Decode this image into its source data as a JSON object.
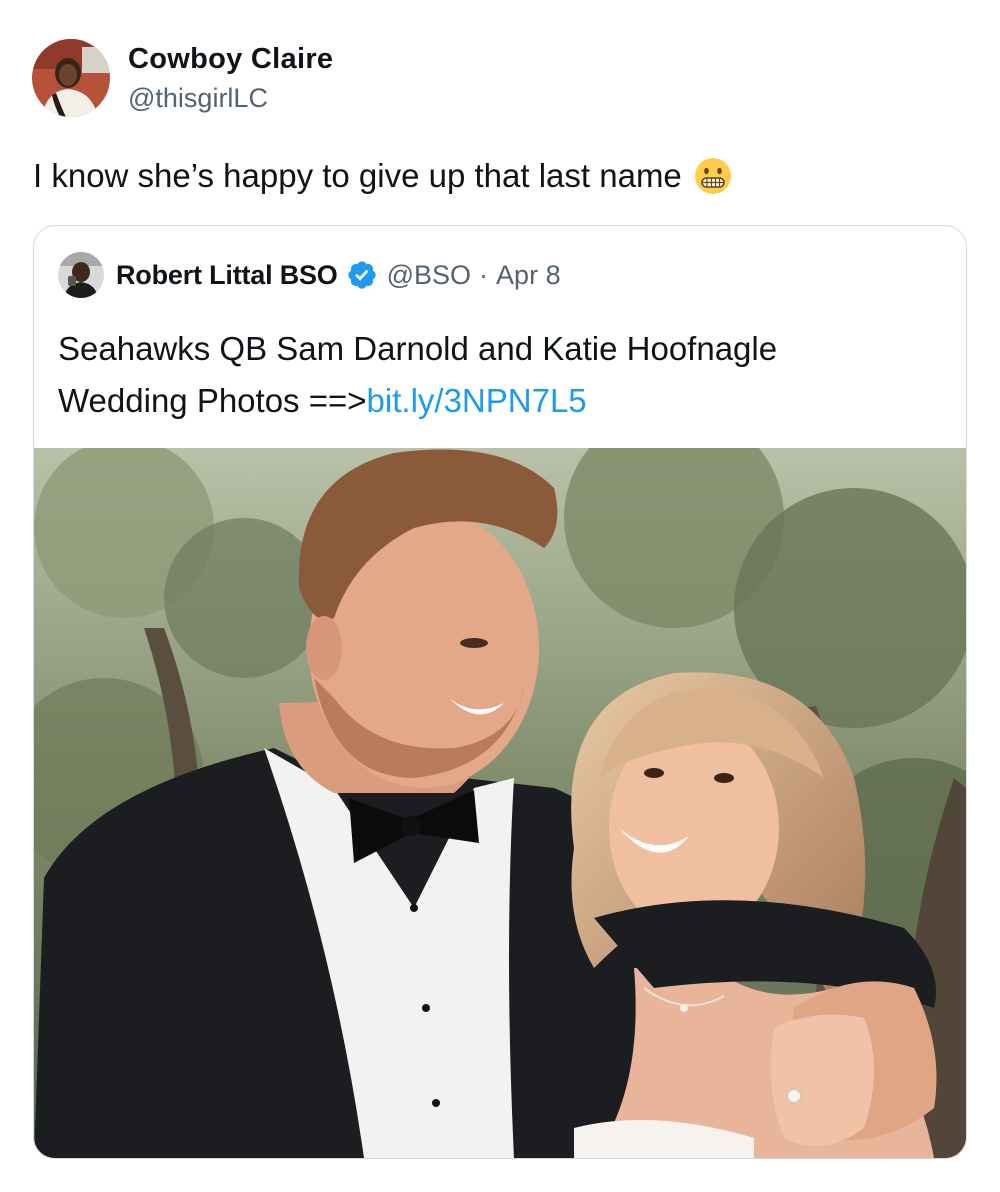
{
  "tweet": {
    "author": {
      "display_name": "Cowboy Claire",
      "handle": "@thisgirlLC",
      "avatar_icon": "profile-photo"
    },
    "text": "I know she’s happy to give up that last name",
    "emoji_icon": "grimacing-face-icon"
  },
  "quoted_tweet": {
    "author": {
      "display_name": "Robert Littal BSO",
      "handle": "@BSO",
      "verified_icon": "verified-badge-icon",
      "avatar_icon": "profile-photo"
    },
    "separator": "·",
    "date": "Apr 8",
    "text_line1": "Seahawks QB Sam Darnold and Katie Hoofnagle",
    "text_line2_prefix": "Wedding Photos ==>",
    "link_text": "bit.ly/3NPN7L5",
    "media_icon": "wedding-photo"
  },
  "colors": {
    "text_primary": "#0f1419",
    "text_secondary": "#536471",
    "link": "#1d9bf0",
    "border": "#cfd9de",
    "verified": "#1d9bf0"
  }
}
